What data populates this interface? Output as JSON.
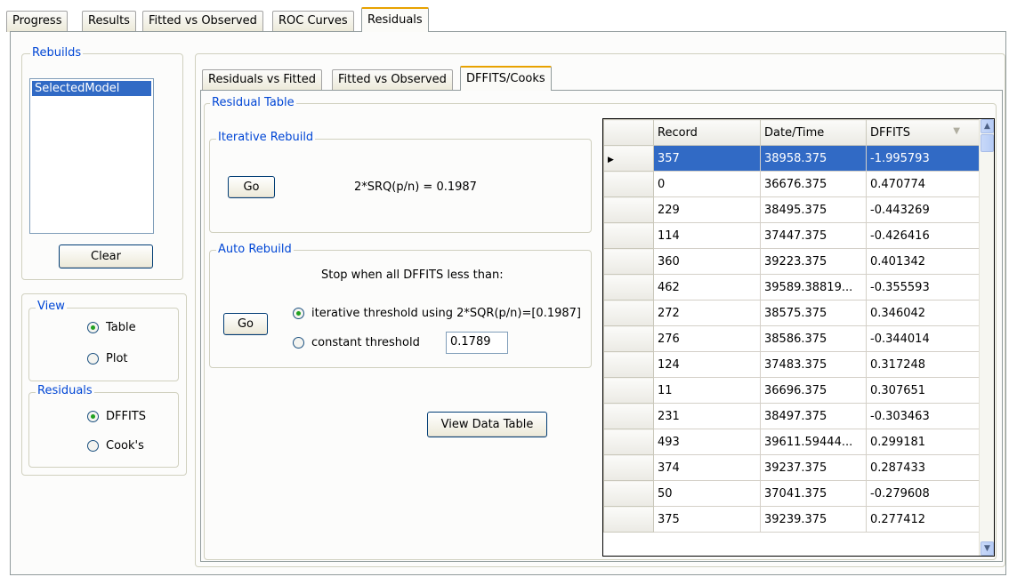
{
  "top_tabs": [
    "Progress",
    "Results",
    "Fitted vs Observed",
    "ROC Curves",
    "Residuals"
  ],
  "rebuilds": {
    "title": "Rebuilds",
    "items": [
      "SelectedModel"
    ],
    "clear_label": "Clear"
  },
  "view": {
    "title": "View",
    "options": [
      "Table",
      "Plot"
    ],
    "selected": "Table"
  },
  "residuals": {
    "title": "Residuals",
    "options": [
      "DFFITS",
      "Cook's"
    ],
    "selected": "DFFITS"
  },
  "sub_tabs": [
    "Residuals vs Fitted",
    "Fitted vs Observed",
    "DFFITS/Cooks"
  ],
  "residual_table_title": "Residual Table",
  "iterative": {
    "title": "Iterative Rebuild",
    "go_label": "Go",
    "formula": "2*SRQ(p/n) = 0.1987"
  },
  "auto": {
    "title": "Auto Rebuild",
    "stop_text": "Stop when all DFFITS less than:",
    "go_label": "Go",
    "option_iterative": "iterative threshold using 2*SQR(p/n)=[0.1987]",
    "option_constant": "constant threshold",
    "constant_value": "0.1789",
    "selected": "iterative"
  },
  "view_data_label": "View Data Table",
  "grid": {
    "columns": [
      "Record",
      "Date/Time",
      "DFFITS"
    ],
    "rows": [
      [
        "357",
        "38958.375",
        "-1.995793"
      ],
      [
        "0",
        "36676.375",
        "0.470774"
      ],
      [
        "229",
        "38495.375",
        "-0.443269"
      ],
      [
        "114",
        "37447.375",
        "-0.426416"
      ],
      [
        "360",
        "39223.375",
        "0.401342"
      ],
      [
        "462",
        "39589.38819...",
        "-0.355593"
      ],
      [
        "272",
        "38575.375",
        "0.346042"
      ],
      [
        "276",
        "38586.375",
        "-0.344014"
      ],
      [
        "124",
        "37483.375",
        "0.317248"
      ],
      [
        "11",
        "36696.375",
        "0.307651"
      ],
      [
        "231",
        "38497.375",
        "-0.303463"
      ],
      [
        "493",
        "39611.59444...",
        "0.299181"
      ],
      [
        "374",
        "39237.375",
        "0.287433"
      ],
      [
        "50",
        "37041.375",
        "-0.279608"
      ],
      [
        "375",
        "39239.375",
        "0.277412"
      ]
    ]
  }
}
